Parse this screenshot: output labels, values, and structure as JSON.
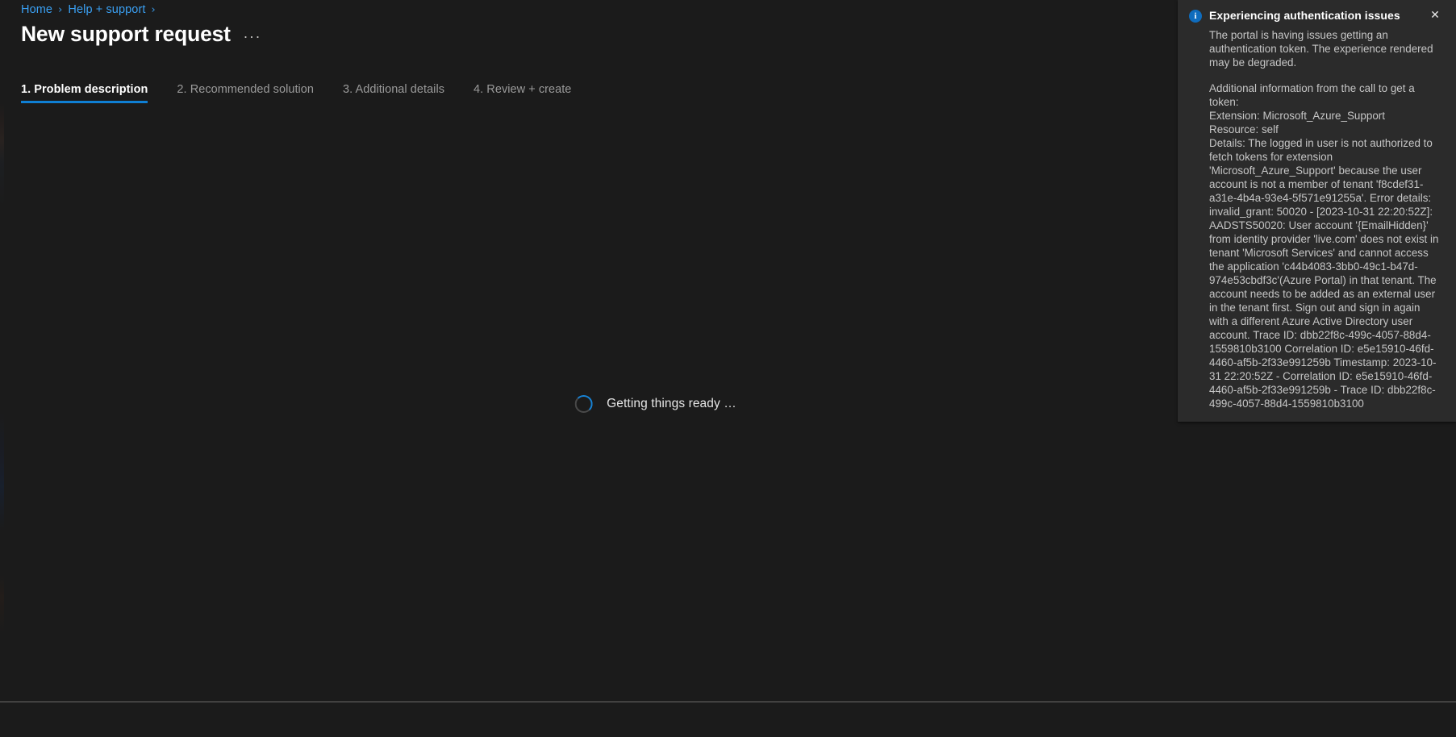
{
  "theme": {
    "page_bg": "#1b1b1b",
    "toast_bg": "#2b2b2b",
    "accent_blue": "#0f7fd4",
    "link_blue": "#3aa0f3",
    "info_badge_blue": "#0f6cbd",
    "divider": "#8a8886",
    "text_primary": "#ffffff",
    "text_secondary": "#c6c6c6",
    "text_muted": "#9a9a9a"
  },
  "breadcrumb": {
    "items": [
      {
        "label": "Home"
      },
      {
        "label": "Help + support"
      }
    ],
    "separator": "›",
    "trailing_separator": "›"
  },
  "header": {
    "title": "New support request",
    "more_menu_label": "···",
    "more_menu_name": "more-options"
  },
  "tabs": [
    {
      "label": "1. Problem description",
      "active": true
    },
    {
      "label": "2. Recommended solution",
      "active": false
    },
    {
      "label": "3. Additional details",
      "active": false
    },
    {
      "label": "4. Review + create",
      "active": false
    }
  ],
  "main": {
    "loading_text": "Getting things ready …",
    "spinner_name": "loading-spinner"
  },
  "notification": {
    "icon": "info-icon",
    "title": "Experiencing authentication issues",
    "close_label": "✕",
    "summary": "The portal is having issues getting an authentication token. The experience rendered may be degraded.",
    "detail_lines": [
      "Additional information from the call to get a token:",
      "Extension: Microsoft_Azure_Support",
      "Resource: self",
      "Details: The logged in user is not authorized to fetch tokens for extension 'Microsoft_Azure_Support' because the user account is not a member of tenant 'f8cdef31-a31e-4b4a-93e4-5f571e91255a'. Error details: invalid_grant: 50020 - [2023-10-31 22:20:52Z]: AADSTS50020: User account '{EmailHidden}' from identity provider 'live.com' does not exist in tenant 'Microsoft Services' and cannot access the application 'c44b4083-3bb0-49c1-b47d-974e53cbdf3c'(Azure Portal) in that tenant. The account needs to be added as an external user in the tenant first. Sign out and sign in again with a different Azure Active Directory user account. Trace ID: dbb22f8c-499c-4057-88d4-1559810b3100 Correlation ID: e5e15910-46fd-4460-af5b-2f33e991259b Timestamp: 2023-10-31 22:20:52Z - Correlation ID: e5e15910-46fd-4460-af5b-2f33e991259b - Trace ID: dbb22f8c-499c-4057-88d4-1559810b3100"
    ]
  }
}
